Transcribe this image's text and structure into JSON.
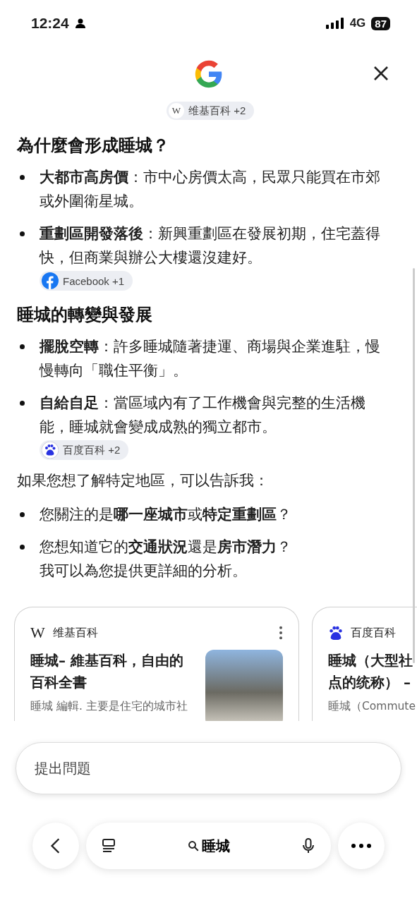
{
  "status_bar": {
    "time": "12:24",
    "network": "4G",
    "battery": "87"
  },
  "top_chip": {
    "logo": "W",
    "label": "维基百科 +2"
  },
  "sections": [
    {
      "heading": "為什麼會形成睡城？",
      "bullets": [
        {
          "text": "**大都市高房價**：市中心房價太高，民眾只能買在市郊或外圍衛星城。"
        },
        {
          "text": "**重劃區開發落後**：新興重劃區在發展初期，住宅蓋得快，但商業與辦公大樓還沒建好。",
          "chip": {
            "kind": "facebook",
            "label": "Facebook +1"
          }
        }
      ]
    },
    {
      "heading": "睡城的轉變與發展",
      "bullets": [
        {
          "text": "**擺脫空轉**：許多睡城隨著捷運、商場與企業進駐，慢慢轉向「職住平衡」。"
        },
        {
          "text": "**自給自足**：當區域內有了工作機會與完整的生活機能，睡城就會變成成熟的獨立都市。",
          "chip": {
            "kind": "baidu",
            "label": "百度百科 +2"
          }
        }
      ]
    }
  ],
  "followup": {
    "intro": "如果您想了解特定地區，可以告訴我：",
    "bullets": [
      {
        "text": "您關注的是**哪一座城市**或**特定重劃區**？"
      },
      {
        "text": "您想知道它的**交通狀況**還是**房市潛力**？",
        "extra": "我可以為您提供更詳細的分析。"
      }
    ]
  },
  "cards": [
    {
      "kind": "wikipedia",
      "logo": "W",
      "source": "维基百科",
      "title": "睡城– 維基百科，自由的百科全書",
      "snippet": "睡城 編輯. 主要是住宅的城市社",
      "has_image": true
    },
    {
      "kind": "baidu",
      "source": "百度百科",
      "title": "睡城（大型社点的统称） –",
      "snippet": "睡城（Commute",
      "has_image": false
    }
  ],
  "ask_field": {
    "placeholder": "提出問題"
  },
  "nav": {
    "query": "睡城"
  }
}
